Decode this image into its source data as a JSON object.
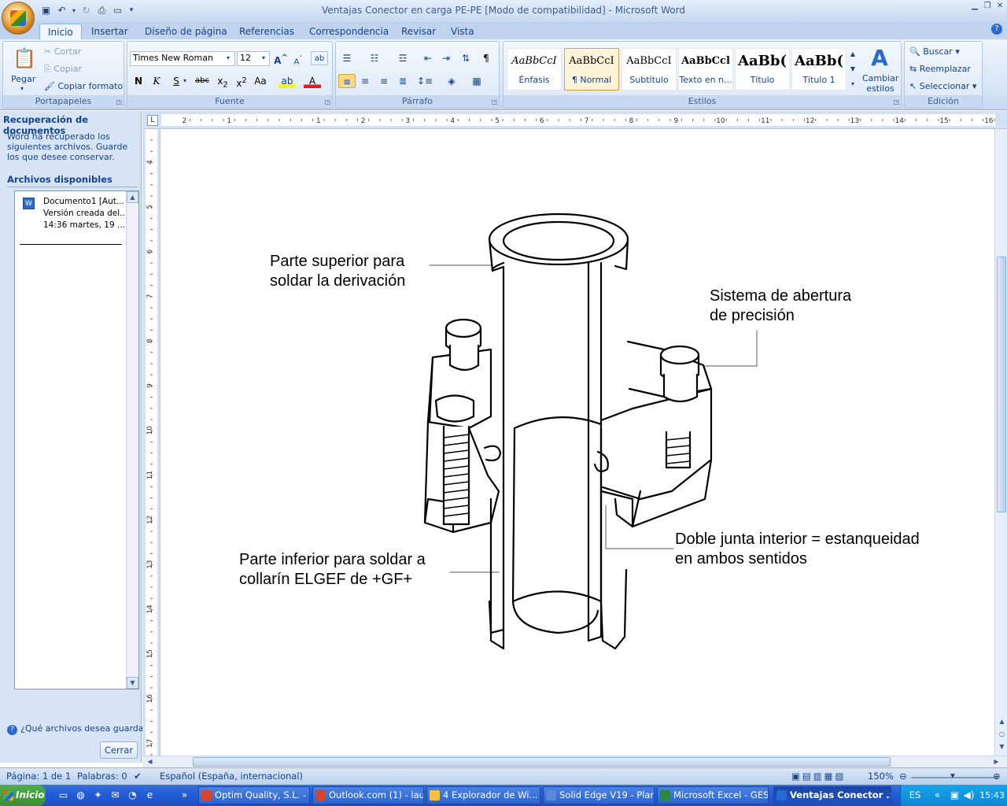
{
  "window": {
    "title": "Ventajas Conector en carga PE-PE [Modo de compatibilidad] - Microsoft Word"
  },
  "ribbon": {
    "tabs": [
      "Inicio",
      "Insertar",
      "Diseño de página",
      "Referencias",
      "Correspondencia",
      "Revisar",
      "Vista"
    ],
    "active_tab": "Inicio",
    "clipboard": {
      "label": "Portapapeles",
      "paste": "Pegar",
      "cut": "Cortar",
      "copy": "Copiar",
      "format_painter": "Copiar formato"
    },
    "font": {
      "label": "Fuente",
      "family": "Times New Roman",
      "size": "12"
    },
    "paragraph": {
      "label": "Párrafo"
    },
    "styles": {
      "label": "Estilos",
      "items": [
        {
          "preview": "AaBbCcI",
          "name": "Énfasis"
        },
        {
          "preview": "AaBbCcI",
          "name": "¶ Normal"
        },
        {
          "preview": "AaBbCcI",
          "name": "Subtítulo"
        },
        {
          "preview": "AaBbCcl",
          "name": "Texto en n..."
        },
        {
          "preview": "AaBb(",
          "name": "Título"
        },
        {
          "preview": "AaBb(",
          "name": "Título 1"
        }
      ],
      "selected": "¶ Normal",
      "change_styles": "Cambiar estilos"
    },
    "editing": {
      "label": "Edición",
      "find": "Buscar",
      "replace": "Reemplazar",
      "select": "Seleccionar"
    }
  },
  "recovery_pane": {
    "title": "Recuperación de documentos",
    "description": "Word ha recuperado los siguientes archivos. Guarde los que desee conservar.",
    "available_label": "Archivos disponibles",
    "file": {
      "line1": "Documento1  [Aut...",
      "line2": "Versión creada del...",
      "line3": "14:36 martes, 19 ..."
    },
    "question": "¿Qué archivos desea guardar?",
    "close_button": "Cerrar"
  },
  "document": {
    "callouts": {
      "top_left": [
        "Parte superior para",
        "soldar la derivación"
      ],
      "top_right": [
        "Sistema de abertura",
        "de precisión"
      ],
      "bottom_left": [
        "Parte inferior para soldar a",
        "collarín ELGEF de +GF+"
      ],
      "bottom_right": [
        "Doble junta interior = estanqueidad",
        "en ambos sentidos"
      ]
    },
    "ruler_h": [
      "2",
      "1",
      "1",
      "2",
      "3",
      "4",
      "5",
      "6",
      "7",
      "8",
      "9",
      "10",
      "11",
      "12",
      "13",
      "14",
      "15",
      "16"
    ],
    "ruler_v": [
      "4",
      "5",
      "6",
      "7",
      "8",
      "9",
      "10",
      "11",
      "12",
      "13",
      "14",
      "15",
      "16",
      "17"
    ]
  },
  "status_bar": {
    "page": "Página: 1 de 1",
    "words": "Palabras: 0",
    "language": "Español (España, internacional)",
    "zoom": "150%"
  },
  "taskbar": {
    "start": "Inicio",
    "tasks": [
      {
        "label": "Optim Quality, S.L. - ...",
        "color": "#d9442c"
      },
      {
        "label": "Outlook.com (1) - lau...",
        "color": "#d9442c"
      },
      {
        "label": "4 Explorador de Wi...",
        "color": "#f0c040"
      },
      {
        "label": "Solid Edge V19 - Plan...",
        "color": "#5a8ad8"
      },
      {
        "label": "Microsoft Excel - GES...",
        "color": "#2a8a3a"
      },
      {
        "label": "Ventajas Conector ...",
        "color": "#2a6ad0"
      }
    ],
    "language": "ES",
    "clock": "15:43"
  }
}
